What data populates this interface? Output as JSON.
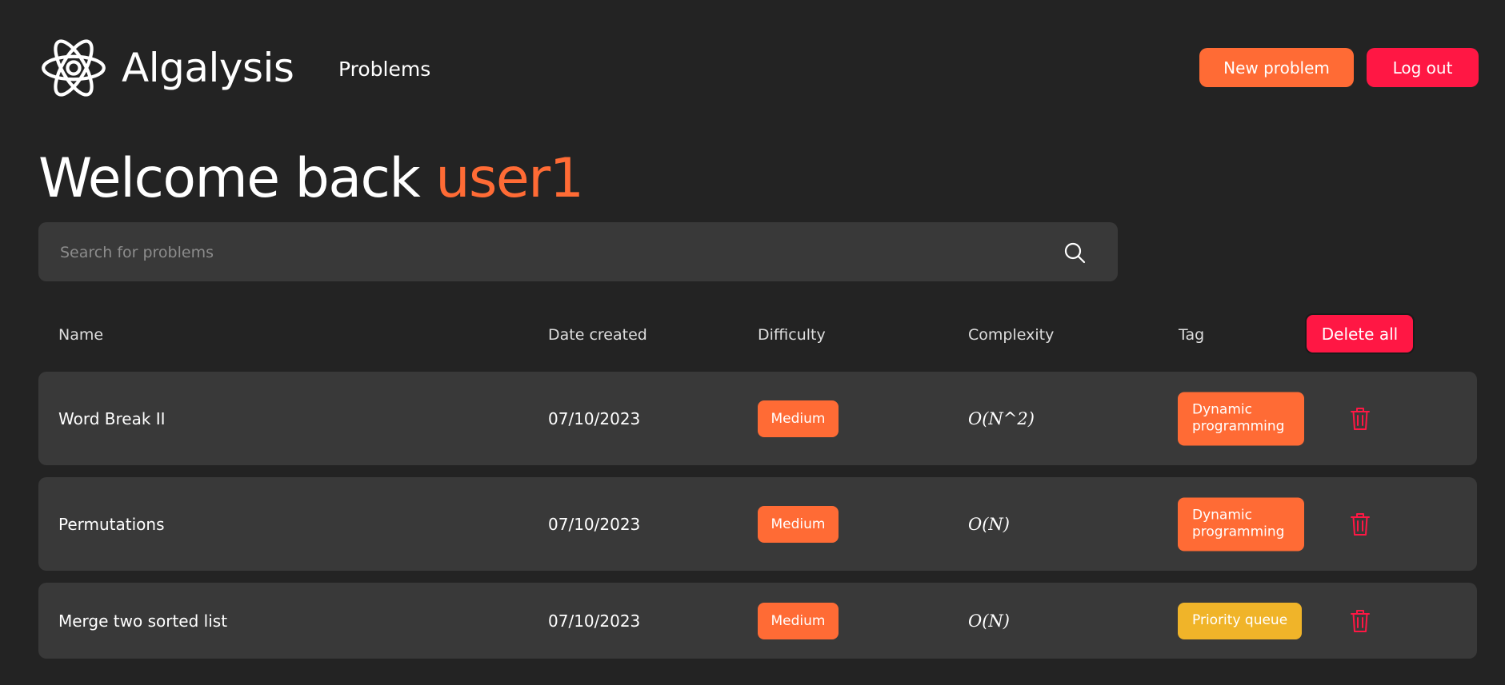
{
  "brand": {
    "name": "Algalysis"
  },
  "nav": {
    "problems": "Problems"
  },
  "actions": {
    "new_problem": "New problem",
    "logout": "Log out",
    "delete_all": "Delete all"
  },
  "welcome": {
    "prefix": "Welcome back",
    "username": "user1"
  },
  "search": {
    "placeholder": "Search for problems",
    "value": ""
  },
  "table": {
    "headers": {
      "name": "Name",
      "date": "Date created",
      "difficulty": "Difficulty",
      "complexity": "Complexity",
      "tag": "Tag"
    },
    "rows": [
      {
        "name": "Word Break II",
        "date": "07/10/2023",
        "difficulty": "Medium",
        "complexity": "O(N^2)",
        "tag": "Dynamic programming"
      },
      {
        "name": "Permutations",
        "date": "07/10/2023",
        "difficulty": "Medium",
        "complexity": "O(N)",
        "tag": "Dynamic programming"
      },
      {
        "name": "Merge two sorted list",
        "date": "07/10/2023",
        "difficulty": "Medium",
        "complexity": "O(N)",
        "tag": "Priority queue"
      }
    ]
  },
  "colors": {
    "background": "#232323",
    "surface": "#393939",
    "accent_orange": "#ff6b35",
    "accent_red": "#ff1744",
    "tag_yellow": "#f0b429"
  },
  "icons": {
    "logo": "atom-icon",
    "search": "search-icon",
    "delete": "trash-icon"
  }
}
